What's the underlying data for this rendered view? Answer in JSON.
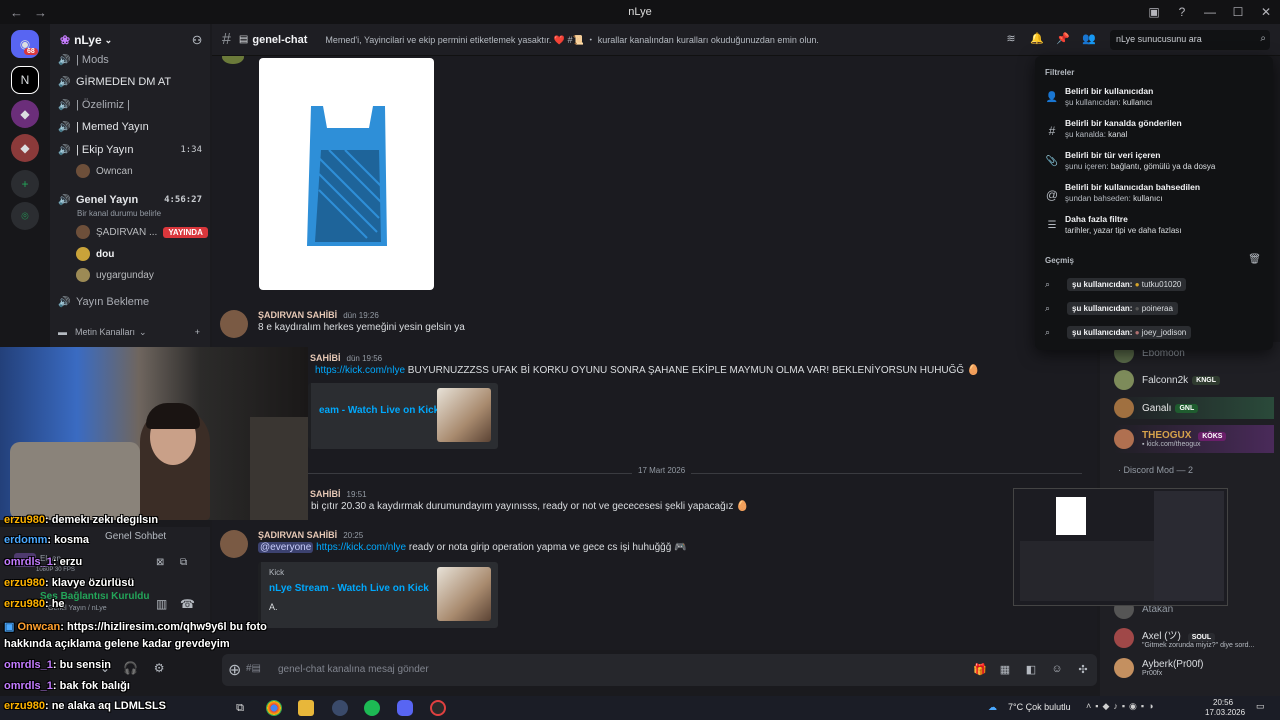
{
  "window": {
    "title": "nLye"
  },
  "server": {
    "name": "nLye",
    "badge": "68"
  },
  "channels": [
    {
      "label": "| Mods"
    },
    {
      "label": "GİRMEDEN DM AT"
    },
    {
      "label": "| Özelimiz |"
    },
    {
      "label": "| Memed Yayın"
    },
    {
      "label": "| Ekip Yayın",
      "time": "1:34"
    },
    {
      "label": "Genel Yayın",
      "time": "4:56:27"
    },
    {
      "label": "Yayın Bekleme"
    }
  ],
  "voice_users_ekip": [
    "Owncan"
  ],
  "genel_status": "Bir kanal durumu belirle",
  "voice_users_genel": [
    {
      "name": "ŞADIRVAN ...",
      "live": "YAYINDA"
    },
    {
      "name": "dou"
    },
    {
      "name": "uygargunday"
    }
  ],
  "category": "Metin Kanalları",
  "topbar": {
    "channel": "genel-chat",
    "topic": "Memed'i, Yayincilari ve ekip permini etiketlemek yasaktır. ❤️ #📜 ・ kurallar kanalından kuralları okuduğunuzdan emin olun.",
    "search_value": "nLye sunucusunu ara"
  },
  "messages": [
    {
      "author": "ŞADIRVAN SAHİBİ",
      "time": "dün 19:26",
      "text": "8 e kaydıralım herkes yemeğini yesin gelsin ya"
    },
    {
      "author": "SAHİBİ",
      "time": "dün 19:56",
      "link": "https://kick.com/nlye",
      "text": " BUYURNUZZZSS UFAK Bİ KORKU OYUNU SONRA ŞAHANE EKİPLE MAYMUN OLMA VAR! BEKLENİYORSUN HUHUĞĞ 🥚",
      "embed_title": "eam - Watch Live on Kick"
    },
    {
      "date": "17 Mart 2026"
    },
    {
      "author": "SAHİBİ",
      "time": "19:51",
      "text": "bi çıtır 20.30 a kaydırmak durumundayım yayınısss, ready or not ve gececesesi şekli yapacağız 🥚"
    },
    {
      "author": "ŞADIRVAN SAHİBİ",
      "time": "20:25",
      "mention": "@everyone",
      "link": "https://kick.com/nlye",
      "text": " ready or nota girip operation yapma ve gece cs işi huhuğğğ 🎮",
      "embed_provider": "Kick",
      "embed_title": "nLye Stream - Watch Live on Kick",
      "embed_desc": "A."
    }
  ],
  "composer": {
    "placeholder": "genel-chat kanalına mesaj gönder"
  },
  "search_popup": {
    "filters_label": "Filtreler",
    "filters": [
      {
        "title": "Belirli bir kullanıcıdan",
        "sub_key": "şu kullanıcıdan:",
        "sub_val": "kullanıcı",
        "icon": "user-icon"
      },
      {
        "title": "Belirli bir kanalda gönderilen",
        "sub_key": "şu kanalda:",
        "sub_val": "kanal",
        "icon": "hash-icon"
      },
      {
        "title": "Belirli bir tür veri içeren",
        "sub_key": "şunu içeren:",
        "sub_val": "bağlantı, gömülü ya da dosya",
        "icon": "paperclip-icon"
      },
      {
        "title": "Belirli bir kullanıcıdan bahsedilen",
        "sub_key": "şundan bahseden:",
        "sub_val": "kullanıcı",
        "icon": "at-icon"
      },
      {
        "title": "Daha fazla filtre",
        "sub_key": "",
        "sub_val": "tarihler, yazar tipi ve daha fazlası",
        "icon": "sliders-icon"
      }
    ],
    "history_label": "Geçmiş",
    "history": [
      {
        "key": "şu kullanıcıdan:",
        "user": "tutku01020"
      },
      {
        "key": "şu kullanıcıdan:",
        "user": "poineraa"
      },
      {
        "key": "şu kullanıcıdan:",
        "user": "joey_jodison"
      }
    ]
  },
  "members": [
    {
      "name": "Falconn2k",
      "tag": "KNGL",
      "color": "#dbdee1"
    },
    {
      "name": "Ganalı",
      "tag": "GNL",
      "color": "#dbdee1"
    },
    {
      "name": "THEOGUX",
      "tag": "KÖKS",
      "color": "#d5a24b",
      "sub": "kick.com/theogux"
    },
    {
      "name": "Atakan",
      "color": "#949ba4"
    },
    {
      "name": "Axel (ツ)",
      "tag": "SOUL",
      "color": "#dbdee1",
      "sub": "\"Gitmek zorunda miyiz?\" diye sord..."
    },
    {
      "name": "Ayberk(Pr00f)",
      "color": "#dbdee1",
      "sub": "Pr00fx"
    }
  ],
  "member_section": "Discord Mod — 2",
  "voice_panel": {
    "genel_sohbet": "Genel Sohbet",
    "connected": "Ses Bağlantısı Kuruldu",
    "sub": "Genel Yayın / nLye",
    "fps": "1080P 30 FPS",
    "screen_label": "Ekran"
  },
  "stream_chat": [
    {
      "user": "erzu980",
      "msg": ": demekı zekı degılsın"
    },
    {
      "user": "erdomm",
      "msg": ": kosma"
    },
    {
      "user": "omrdls_1",
      "msg": ": erzu"
    },
    {
      "user": "erzu980",
      "msg": ": klavye özürlüsü"
    },
    {
      "user": "erzu980",
      "msg": ": he"
    },
    {
      "user": "Onwcan",
      "msg": ": https://hizliresim.com/qhw9y6l bu foto"
    },
    {
      "user": "",
      "msg": "hakkında açıklama gelene kadar grevdeyim"
    },
    {
      "user": "omrdls_1",
      "msg": ": bu sensin"
    },
    {
      "user": "omrdls_1",
      "msg": ": bak fok balığı"
    },
    {
      "user": "erzu980",
      "msg": ": ne alaka aq LDMLSLS"
    }
  ],
  "taskbar": {
    "weather": "7°C  Çok bulutlu",
    "time": "20:56",
    "date": "17.03.2026"
  }
}
